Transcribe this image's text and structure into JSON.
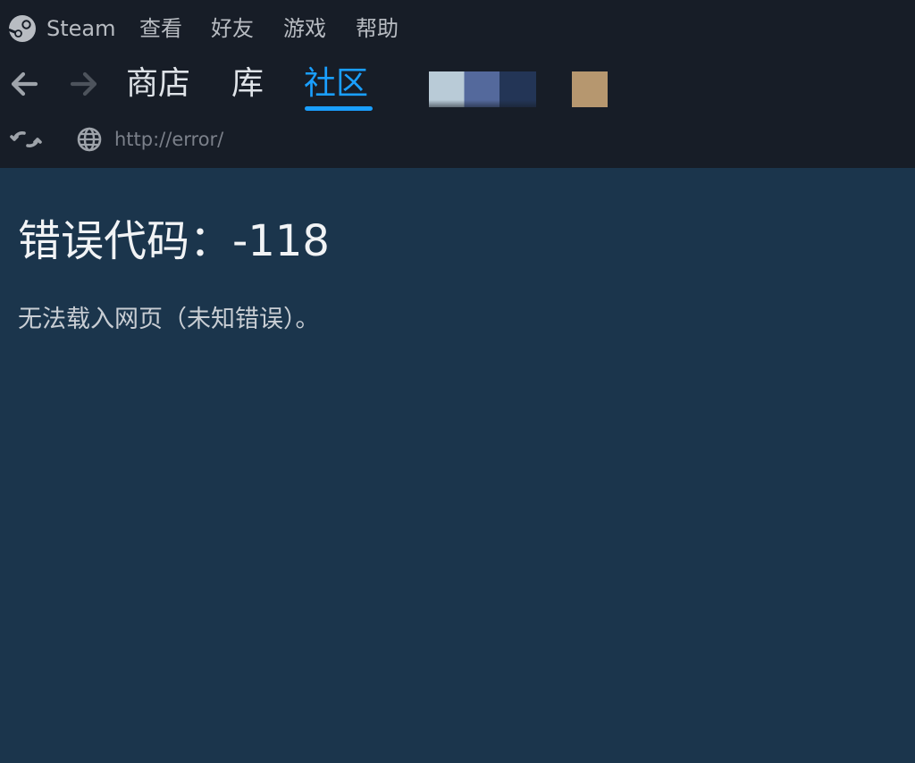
{
  "menubar": {
    "logo_icon": "steam-logo-icon",
    "items": [
      "Steam",
      "查看",
      "好友",
      "游戏",
      "帮助"
    ]
  },
  "nav": {
    "back_icon": "arrow-left-icon",
    "forward_icon": "arrow-right-icon",
    "tabs": [
      {
        "label": "商店",
        "active": false
      },
      {
        "label": "库",
        "active": false
      },
      {
        "label": "社区",
        "active": true
      }
    ],
    "active_color": "#1a9fff"
  },
  "address": {
    "reload_icon": "reload-icon",
    "globe_icon": "globe-icon",
    "url": "http://error/"
  },
  "content": {
    "title": "错误代码：-118",
    "message": "无法载入网页（未知错误）。"
  },
  "colors": {
    "chrome_bg": "#171d27",
    "page_bg": "#1b354c"
  }
}
